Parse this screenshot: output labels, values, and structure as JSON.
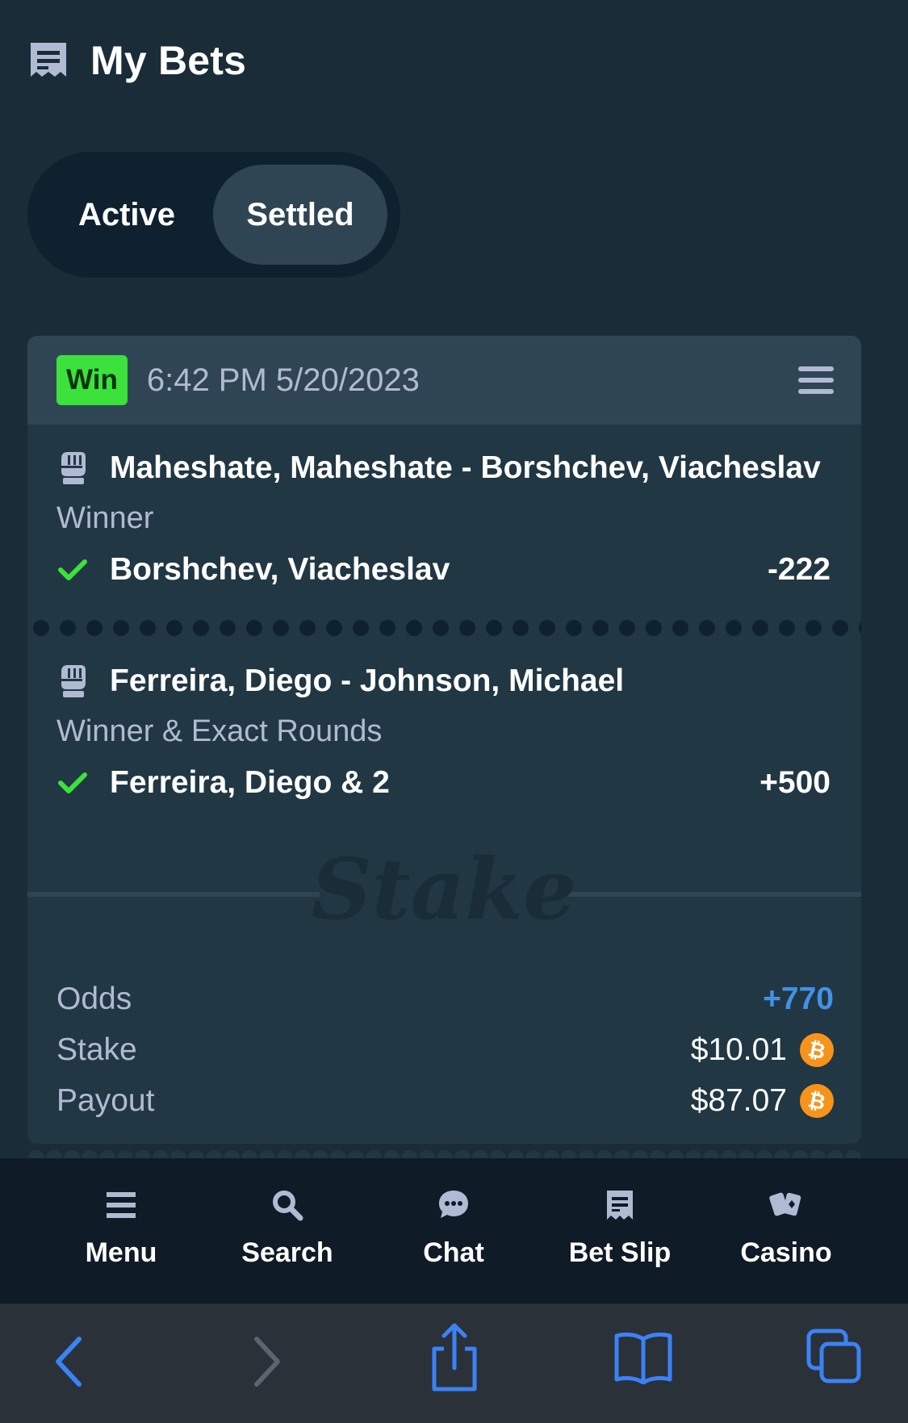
{
  "header": {
    "title": "My Bets",
    "icon": "bet-slip-icon"
  },
  "tabs": [
    {
      "label": "Active",
      "selected": false
    },
    {
      "label": "Settled",
      "selected": true
    }
  ],
  "bet": {
    "status": "Win",
    "datetime": "6:42 PM 5/20/2023",
    "legs": [
      {
        "event": "Maheshate, Maheshate - Borshchev, Viacheslav",
        "market": "Winner",
        "pick": "Borshchev, Viacheslav",
        "odds": "-222",
        "sport_icon": "mma-glove-icon",
        "result_icon": "check-icon"
      },
      {
        "event": "Ferreira, Diego - Johnson, Michael",
        "market": "Winner & Exact Rounds",
        "pick": "Ferreira, Diego & 2",
        "odds": "+500",
        "sport_icon": "mma-glove-icon",
        "result_icon": "check-icon"
      }
    ],
    "watermark": "Stake",
    "summary": {
      "odds_label": "Odds",
      "odds_value": "+770",
      "stake_label": "Stake",
      "stake_value": "$10.01",
      "payout_label": "Payout",
      "payout_value": "$87.07",
      "currency_icon": "bitcoin-icon",
      "currency_symbol": "₿"
    }
  },
  "bottom_nav": [
    {
      "label": "Menu",
      "icon": "menu-icon"
    },
    {
      "label": "Search",
      "icon": "search-icon"
    },
    {
      "label": "Chat",
      "icon": "chat-icon"
    },
    {
      "label": "Bet Slip",
      "icon": "bet-slip-icon"
    },
    {
      "label": "Casino",
      "icon": "cards-icon"
    }
  ],
  "colors": {
    "background": "#1a2c38",
    "card": "#213743",
    "card_header": "#2f4553",
    "win_green": "#3ce13c",
    "odds_blue": "#4391e7",
    "bitcoin_orange": "#f7931a",
    "browser_blue": "#3b82f6"
  }
}
